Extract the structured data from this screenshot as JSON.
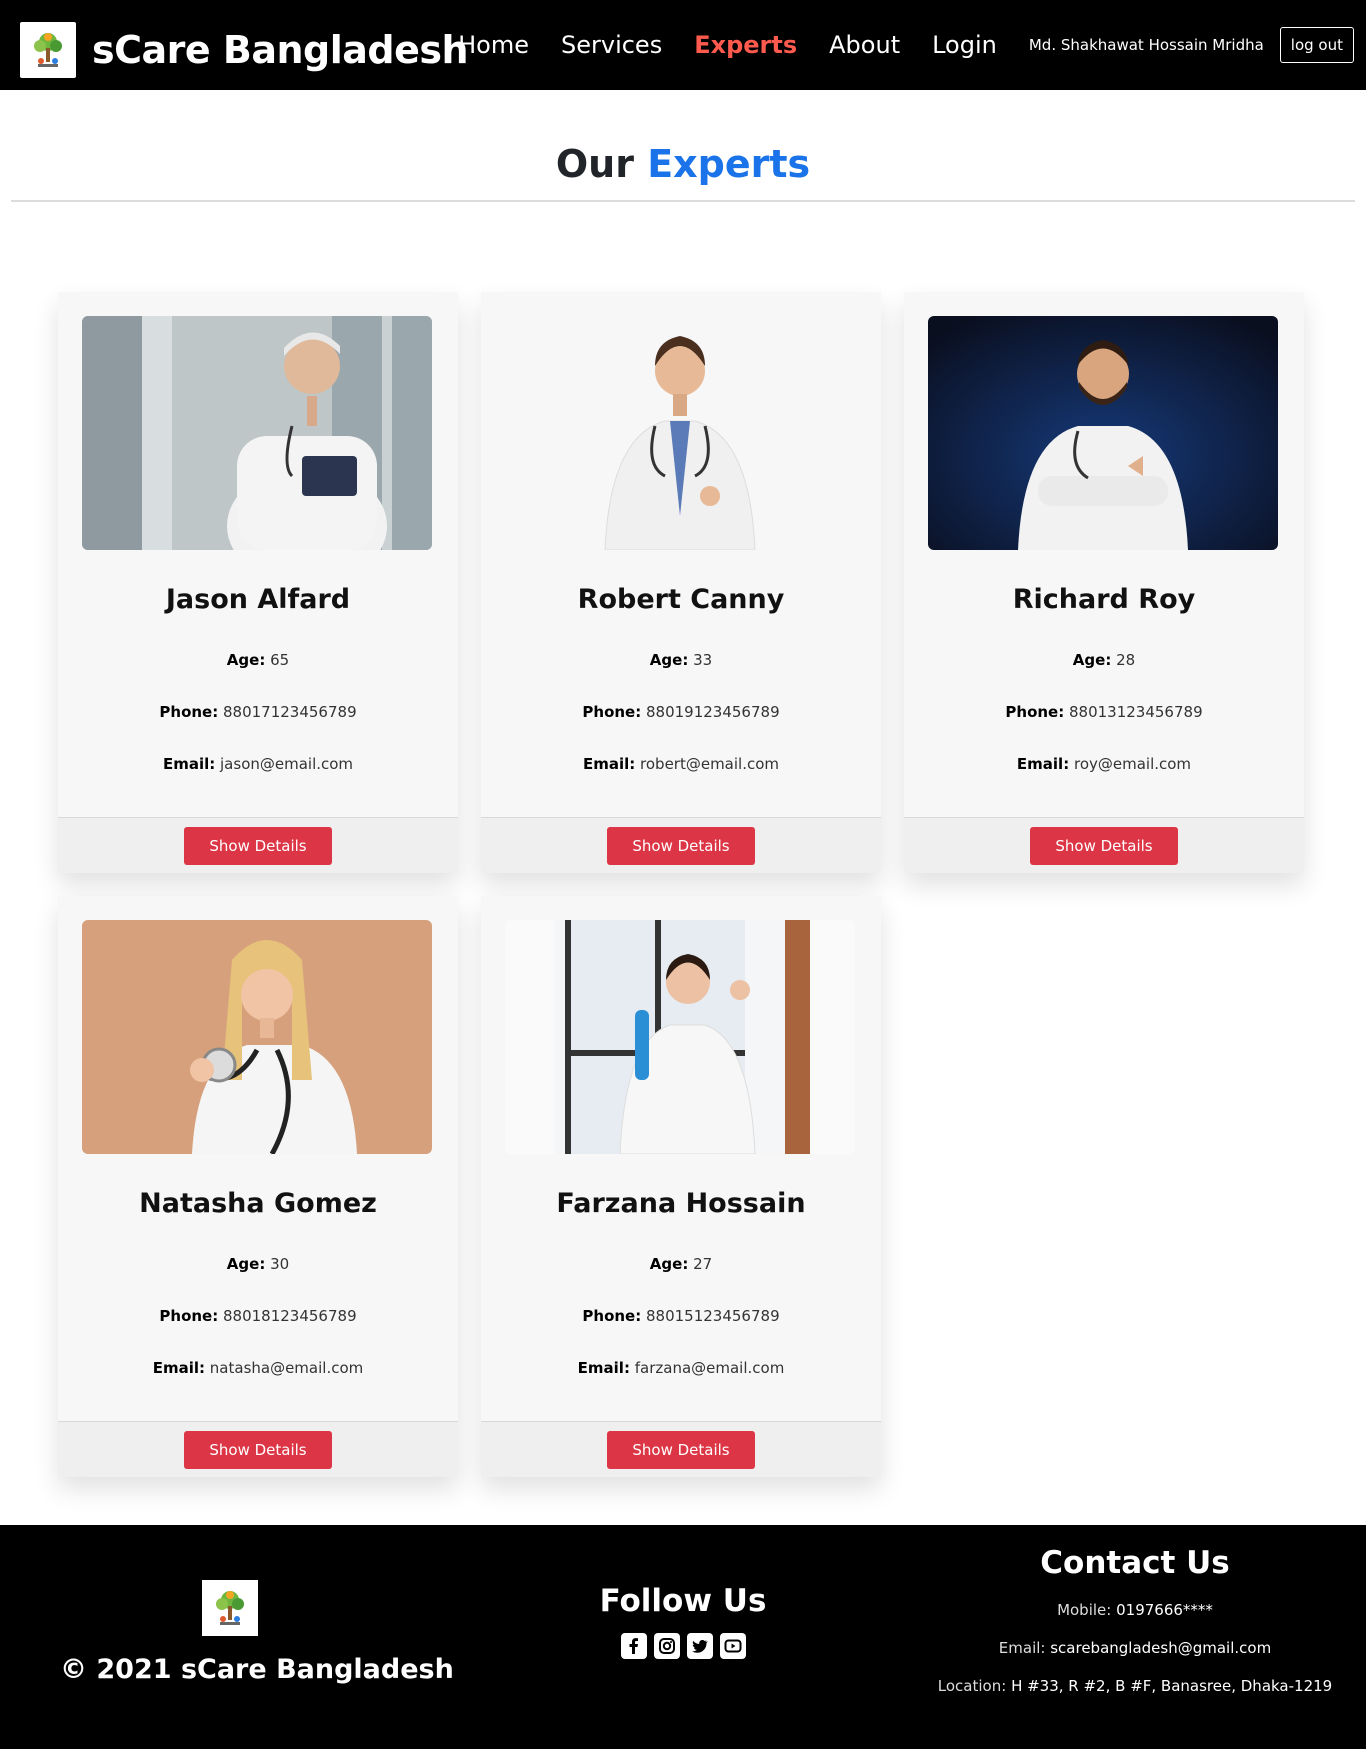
{
  "navbar": {
    "brand": "sCare Bangladesh",
    "links": [
      "Home",
      "Services",
      "Experts",
      "About",
      "Login"
    ],
    "user": "Md. Shakhawat Hossain Mridha",
    "logout": "log out"
  },
  "heading": {
    "prefix": "Our",
    "accent": "Experts"
  },
  "labels": {
    "age": "Age:",
    "phone": "Phone:",
    "email": "Email:",
    "button": "Show Details"
  },
  "experts": [
    {
      "name": "Jason Alfard",
      "age": "65",
      "phone": "88017123456789",
      "email": "jason@email.com"
    },
    {
      "name": "Robert Canny",
      "age": "33",
      "phone": "88019123456789",
      "email": "robert@email.com"
    },
    {
      "name": "Richard Roy",
      "age": "28",
      "phone": "88013123456789",
      "email": "roy@email.com"
    },
    {
      "name": "Natasha Gomez",
      "age": "30",
      "phone": "88018123456789",
      "email": "natasha@email.com"
    },
    {
      "name": "Farzana Hossain",
      "age": "27",
      "phone": "88015123456789",
      "email": "farzana@email.com"
    }
  ],
  "footer": {
    "copyright": "© 2021 sCare Bangladesh",
    "follow_title": "Follow Us",
    "social": [
      "facebook-icon",
      "instagram-icon",
      "twitter-icon",
      "youtube-icon"
    ],
    "contact_title": "Contact Us",
    "mobile_label": "Mobile:",
    "mobile": "0197666****",
    "email_label": "Email:",
    "email": "scarebangladesh@gmail.com",
    "location_label": "Location:",
    "location": "H #33, R #2, B #F, Banasree, Dhaka-1219"
  },
  "colors": {
    "accent_blue": "#1a73e8",
    "active_nav": "#ff5a4e",
    "button_red": "#dc3545"
  }
}
